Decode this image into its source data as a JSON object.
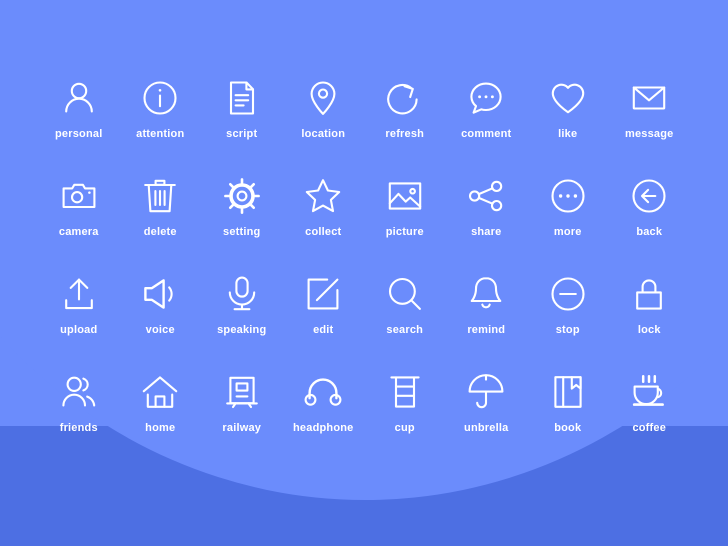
{
  "page": {
    "background_color": "#6b8cfc",
    "accent_color": "#4d6fe3",
    "icon_color": "#ffffff",
    "columns": 8,
    "rows": 4,
    "total_icons": 32
  },
  "icons": [
    {
      "id": "personal",
      "label": "personal",
      "icon_name": "person-icon",
      "row": 1,
      "col": 1
    },
    {
      "id": "attention",
      "label": "attention",
      "icon_name": "info-circle-icon",
      "row": 1,
      "col": 2
    },
    {
      "id": "script",
      "label": "script",
      "icon_name": "document-icon",
      "row": 1,
      "col": 3
    },
    {
      "id": "location",
      "label": "location",
      "icon_name": "map-pin-icon",
      "row": 1,
      "col": 4
    },
    {
      "id": "refresh",
      "label": "refresh",
      "icon_name": "refresh-arrow-icon",
      "row": 1,
      "col": 5
    },
    {
      "id": "comment",
      "label": "comment",
      "icon_name": "speech-bubble-icon",
      "row": 1,
      "col": 6
    },
    {
      "id": "like",
      "label": "like",
      "icon_name": "heart-icon",
      "row": 1,
      "col": 7
    },
    {
      "id": "message",
      "label": "message",
      "icon_name": "envelope-icon",
      "row": 1,
      "col": 8
    },
    {
      "id": "camera",
      "label": "camera",
      "icon_name": "camera-icon",
      "row": 2,
      "col": 1
    },
    {
      "id": "delete",
      "label": "delete",
      "icon_name": "trash-can-icon",
      "row": 2,
      "col": 2
    },
    {
      "id": "setting",
      "label": "setting",
      "icon_name": "gear-icon",
      "row": 2,
      "col": 3
    },
    {
      "id": "collect",
      "label": "collect",
      "icon_name": "star-icon",
      "row": 2,
      "col": 4
    },
    {
      "id": "picture",
      "label": "picture",
      "icon_name": "image-icon",
      "row": 2,
      "col": 5
    },
    {
      "id": "share",
      "label": "share",
      "icon_name": "share-nodes-icon",
      "row": 2,
      "col": 6
    },
    {
      "id": "more",
      "label": "more",
      "icon_name": "ellipsis-circle-icon",
      "row": 2,
      "col": 7
    },
    {
      "id": "back",
      "label": "back",
      "icon_name": "arrow-left-circle-icon",
      "row": 2,
      "col": 8
    },
    {
      "id": "upload",
      "label": "upload",
      "icon_name": "upload-icon",
      "row": 3,
      "col": 1
    },
    {
      "id": "voice",
      "label": "voice",
      "icon_name": "speaker-icon",
      "row": 3,
      "col": 2
    },
    {
      "id": "speaking",
      "label": "speaking",
      "icon_name": "microphone-icon",
      "row": 3,
      "col": 3
    },
    {
      "id": "edit",
      "label": "edit",
      "icon_name": "pencil-square-icon",
      "row": 3,
      "col": 4
    },
    {
      "id": "search",
      "label": "search",
      "icon_name": "search-icon",
      "row": 3,
      "col": 5
    },
    {
      "id": "remind",
      "label": "remind",
      "icon_name": "bell-icon",
      "row": 3,
      "col": 6
    },
    {
      "id": "stop",
      "label": "stop",
      "icon_name": "minus-circle-icon",
      "row": 3,
      "col": 7
    },
    {
      "id": "lock",
      "label": "lock",
      "icon_name": "lock-icon",
      "row": 3,
      "col": 8
    },
    {
      "id": "friends",
      "label": "friends",
      "icon_name": "two-people-icon",
      "row": 4,
      "col": 1
    },
    {
      "id": "home",
      "label": "home",
      "icon_name": "house-icon",
      "row": 4,
      "col": 2
    },
    {
      "id": "railway",
      "label": "railway",
      "icon_name": "train-icon",
      "row": 4,
      "col": 3
    },
    {
      "id": "headphone",
      "label": "headphone",
      "icon_name": "headphones-icon",
      "row": 4,
      "col": 4
    },
    {
      "id": "cup",
      "label": "cup",
      "icon_name": "cup-icon",
      "row": 4,
      "col": 5
    },
    {
      "id": "unbrella",
      "label": "unbrella",
      "icon_name": "umbrella-icon",
      "row": 4,
      "col": 6
    },
    {
      "id": "book",
      "label": "book",
      "icon_name": "book-icon",
      "row": 4,
      "col": 7
    },
    {
      "id": "coffee",
      "label": "coffee",
      "icon_name": "coffee-cup-icon",
      "row": 4,
      "col": 8
    }
  ]
}
